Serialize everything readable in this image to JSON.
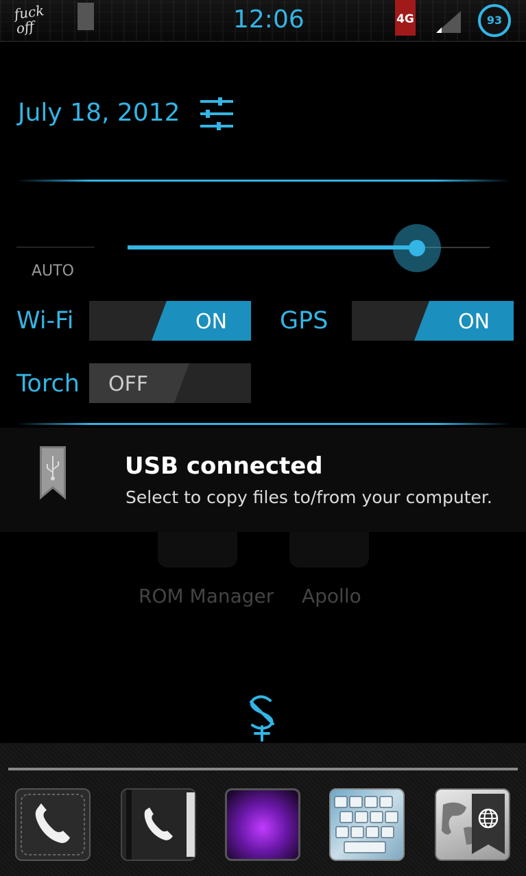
{
  "status_bar": {
    "logo_text": "fuck off",
    "time": "12:06",
    "network": "4G",
    "battery": "93"
  },
  "header": {
    "date": "July 18, 2012",
    "settings_icon": "sliders-icon"
  },
  "brightness": {
    "auto_label": "AUTO",
    "level_fraction": 0.8
  },
  "toggles": [
    {
      "label": "Wi-Fi",
      "state": "ON"
    },
    {
      "label": "GPS",
      "state": "ON"
    },
    {
      "label": "Torch",
      "state": "OFF"
    }
  ],
  "notification": {
    "icon": "usb-icon",
    "title": "USB connected",
    "subtitle": "Select to copy files to/from your computer."
  },
  "background_apps": [
    {
      "label": "ROM Manager"
    },
    {
      "label": "Apollo"
    }
  ],
  "dock": {
    "apps": [
      {
        "icon": "phone-icon"
      },
      {
        "icon": "contacts-icon"
      },
      {
        "icon": "purple-grid-app-icon"
      },
      {
        "icon": "keyboard-app-icon"
      },
      {
        "icon": "browser-globe-icon"
      }
    ]
  },
  "colors": {
    "accent": "#33b5e5",
    "background": "#000000",
    "toggle_on": "#1b8fbd"
  }
}
